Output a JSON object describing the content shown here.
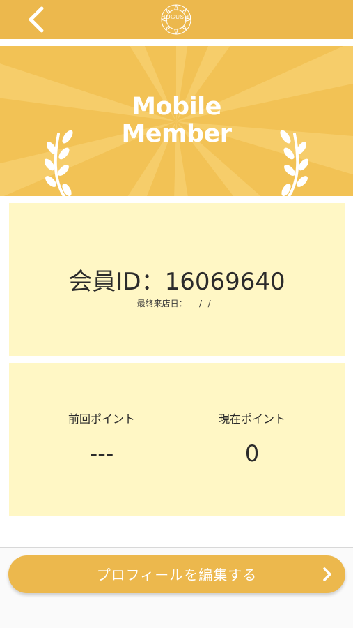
{
  "header": {
    "logo_text": "HOGUSHI",
    "back_icon": "chevron-left-icon"
  },
  "banner": {
    "title_line1": "Mobile",
    "title_line2": "Member"
  },
  "member": {
    "id_label": "会員ID：",
    "id_value": "16069640",
    "last_visit_label": "最終来店日：",
    "last_visit_value": "----/--/--"
  },
  "points": {
    "previous_label": "前回ポイント",
    "previous_value": "---",
    "current_label": "現在ポイント",
    "current_value": "0"
  },
  "actions": {
    "edit_profile_label": "プロフィールを編集する",
    "edit_profile_icon": "chevron-right-icon"
  },
  "colors": {
    "header": "#ecb84d",
    "banner": "#f2c255",
    "card": "#fff7c5",
    "button": "#ecb84d"
  }
}
